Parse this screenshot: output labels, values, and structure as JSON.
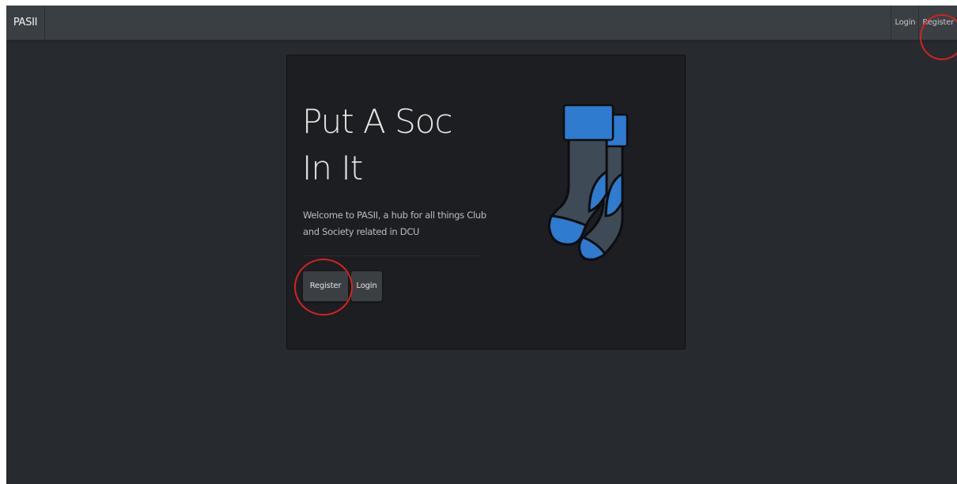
{
  "navbar": {
    "brand": "PASII",
    "links": [
      {
        "label": "Login"
      },
      {
        "label": "Register"
      }
    ]
  },
  "hero": {
    "title_line1": "Put A Soc",
    "title_line2": "In It",
    "description": "Welcome to PASII, a hub for all things Club and Society related in DCU",
    "register_label": "Register",
    "login_label": "Login"
  },
  "colors": {
    "page_background": "#272b30",
    "navbar_background": "#3a3f44",
    "card_background": "#1c1e22",
    "sock_blue": "#2e7bcf",
    "sock_gray": "#3e4a55",
    "annotation_red": "#d82020"
  },
  "icons": {
    "logo": "socks-icon"
  }
}
